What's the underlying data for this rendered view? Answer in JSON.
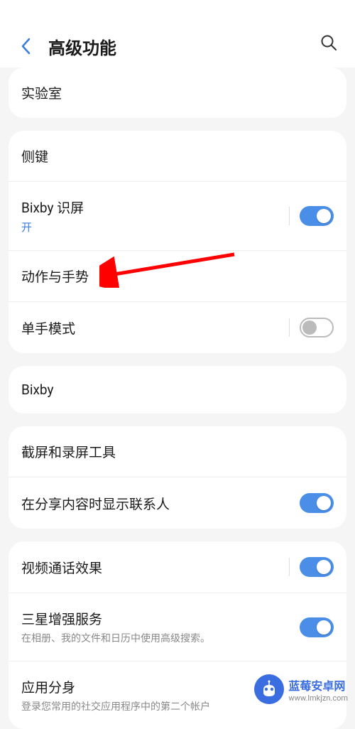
{
  "header": {
    "title": "高级功能"
  },
  "sections": {
    "labs": {
      "label": "实验室"
    },
    "sideKey": {
      "label": "侧键"
    },
    "bixbyVision": {
      "label": "Bixby 识屏",
      "status": "开"
    },
    "motion": {
      "label": "动作与手势"
    },
    "oneHand": {
      "label": "单手模式"
    },
    "bixby": {
      "label": "Bixby"
    },
    "screenshot": {
      "label": "截屏和录屏工具"
    },
    "shareContacts": {
      "label": "在分享内容时显示联系人"
    },
    "videoEffect": {
      "label": "视频通话效果"
    },
    "samsungEnhance": {
      "label": "三星增强服务",
      "sub": "在相册、我的文件和日历中使用高级搜索。"
    },
    "appTwin": {
      "label": "应用分身",
      "sub": "登录您常用的社交应用程序中的第二个帐户"
    }
  },
  "watermark": {
    "title": "蓝莓安卓网",
    "url": "www.lmkjzn.com"
  }
}
